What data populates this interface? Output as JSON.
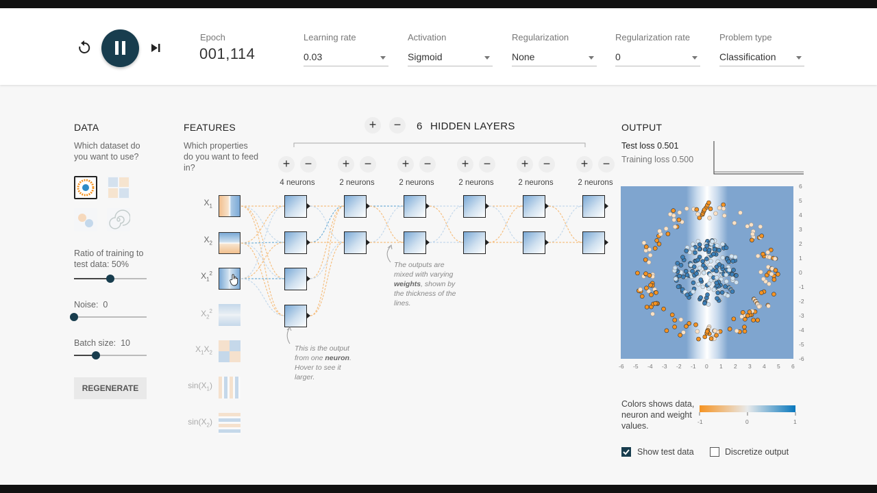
{
  "header": {
    "epoch_label": "Epoch",
    "epoch_value": "001,114",
    "controls": [
      {
        "label": "Learning rate",
        "value": "0.03"
      },
      {
        "label": "Activation",
        "value": "Sigmoid"
      },
      {
        "label": "Regularization",
        "value": "None"
      },
      {
        "label": "Regularization rate",
        "value": "0"
      },
      {
        "label": "Problem type",
        "value": "Classification"
      }
    ]
  },
  "data_panel": {
    "title": "DATA",
    "question": "Which dataset do you want to use?",
    "ratio_label": "Ratio of training to test data:",
    "ratio_value": "50%",
    "ratio_fraction": 0.5,
    "noise_label": "Noise:",
    "noise_value": "0",
    "noise_fraction": 0,
    "batch_label": "Batch size:",
    "batch_value": "10",
    "batch_fraction": 0.3,
    "regenerate": "REGENERATE"
  },
  "features": {
    "title": "FEATURES",
    "question": "Which properties do you want to feed in?",
    "items": [
      {
        "base": "X",
        "sub": "1",
        "sup": "",
        "active": true
      },
      {
        "base": "X",
        "sub": "2",
        "sup": "",
        "active": true
      },
      {
        "base": "X",
        "sub": "1",
        "sup": "2",
        "active": true
      },
      {
        "base": "X",
        "sub": "2",
        "sup": "2",
        "active": false
      },
      {
        "base": "X",
        "sub": "1",
        "mid": "X",
        "sub2": "2",
        "active": false
      },
      {
        "base": "sin(X",
        "sub": "1",
        "tail": ")",
        "active": false
      },
      {
        "base": "sin(X",
        "sub": "2",
        "tail": ")",
        "active": false
      }
    ]
  },
  "network": {
    "hidden_count": "6",
    "hidden_label": "HIDDEN LAYERS",
    "layers": [
      {
        "label": "4 neurons",
        "neurons": 4
      },
      {
        "label": "2 neurons",
        "neurons": 2
      },
      {
        "label": "2 neurons",
        "neurons": 2
      },
      {
        "label": "2 neurons",
        "neurons": 2
      },
      {
        "label": "2 neurons",
        "neurons": 2
      },
      {
        "label": "2 neurons",
        "neurons": 2
      }
    ],
    "plus": "+",
    "minus": "−",
    "note_neuron_pre": "This is the output from one",
    "note_neuron_bold": "neuron",
    "note_neuron_post": ". Hover to see it larger.",
    "note_weights_pre": "The outputs are mixed with varying",
    "note_weights_bold": "weights",
    "note_weights_post": ", shown by the thickness of the lines."
  },
  "output": {
    "title": "OUTPUT",
    "test_loss_label": "Test loss",
    "test_loss": "0.501",
    "train_loss_label": "Training loss",
    "train_loss": "0.500",
    "x_ticks": [
      "-6",
      "-5",
      "-4",
      "-3",
      "-2",
      "-1",
      "0",
      "1",
      "2",
      "3",
      "4",
      "5",
      "6"
    ],
    "y_ticks": [
      "6",
      "5",
      "4",
      "3",
      "2",
      "1",
      "0",
      "-1",
      "-2",
      "-3",
      "-4",
      "-5",
      "-6"
    ],
    "legend_text": "Colors shows data, neuron and weight values.",
    "legend_min": "-1",
    "legend_mid": "0",
    "legend_max": "1",
    "show_test_label": "Show test data",
    "show_test_checked": true,
    "discretize_label": "Discretize output",
    "discretize_checked": false
  },
  "colors": {
    "dark": "#183d4e",
    "orange": "#f59322",
    "blue": "#0877bd",
    "bg_blue": "#7fa5cf"
  }
}
